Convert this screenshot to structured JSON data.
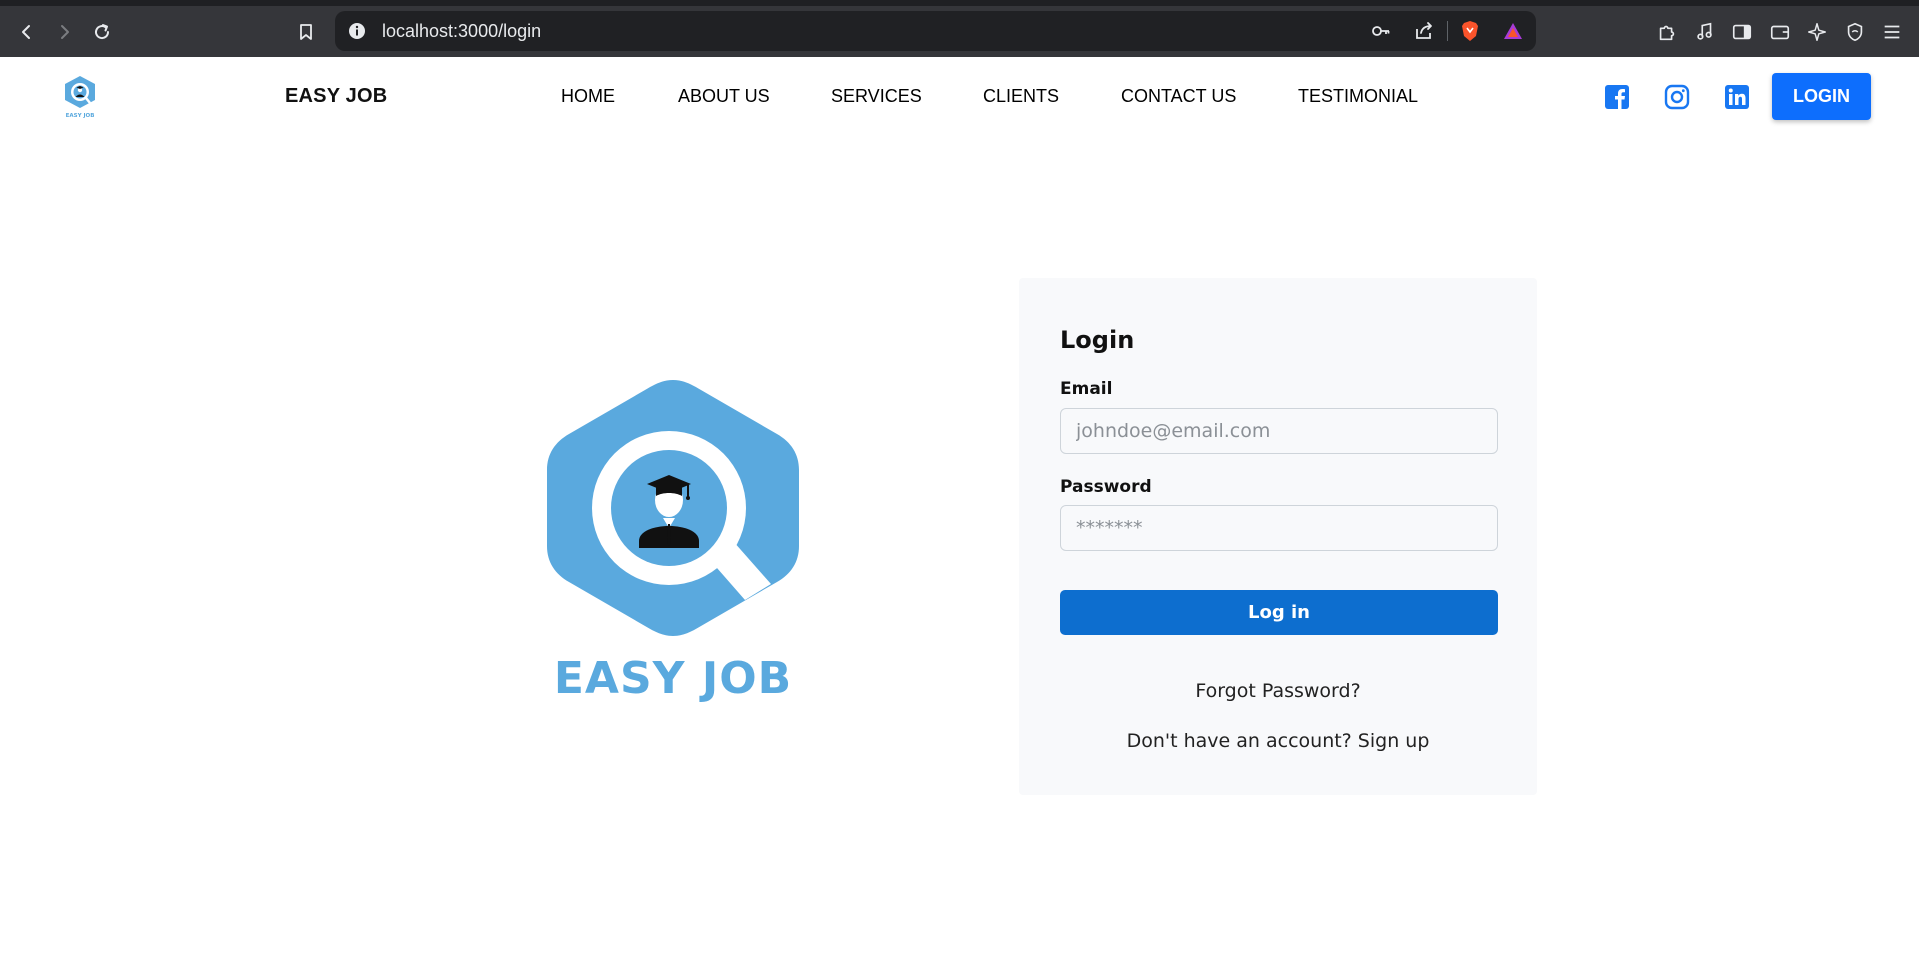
{
  "browser": {
    "url": "localhost:3000/login",
    "icons": [
      "back-icon",
      "forward-icon",
      "reload-icon",
      "bookmark-icon",
      "info-icon",
      "key-icon",
      "share-icon",
      "brave-shield-icon",
      "brave-rewards-icon",
      "extensions-icon",
      "music-icon",
      "sidebar-icon",
      "wallet-icon",
      "leo-icon",
      "vpn-icon",
      "menu-icon"
    ]
  },
  "header": {
    "brand": "EASY JOB",
    "logo_caption": "EASY JOB",
    "nav": [
      {
        "label": "HOME"
      },
      {
        "label": "ABOUT US"
      },
      {
        "label": "SERVICES"
      },
      {
        "label": "CLIENTS"
      },
      {
        "label": "CONTACT US"
      },
      {
        "label": "TESTIMONIAL"
      }
    ],
    "social": [
      "facebook-icon",
      "instagram-icon",
      "linkedin-icon"
    ],
    "login_label": "LOGIN"
  },
  "hero": {
    "title": "EASY JOB"
  },
  "login_form": {
    "title": "Login",
    "email_label": "Email",
    "email_placeholder": "johndoe@email.com",
    "email_value": "",
    "password_label": "Password",
    "password_placeholder": "*******",
    "password_value": "",
    "submit_label": "Log in",
    "forgot_label": "Forgot Password?",
    "signup_label": "Don't have an account? Sign up"
  },
  "colors": {
    "accent": "#0d6efd",
    "submit": "#0d6ecf",
    "logo_blue": "#5aa9de",
    "card_bg": "#f8f9fb"
  }
}
